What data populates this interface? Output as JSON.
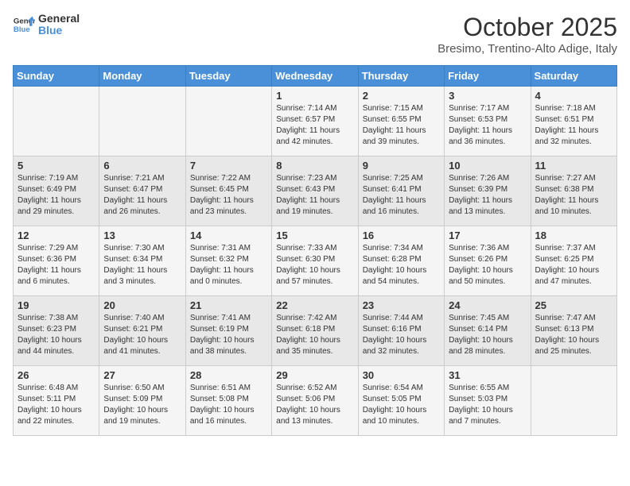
{
  "header": {
    "logo_line1": "General",
    "logo_line2": "Blue",
    "month": "October 2025",
    "location": "Bresimo, Trentino-Alto Adige, Italy"
  },
  "days_of_week": [
    "Sunday",
    "Monday",
    "Tuesday",
    "Wednesday",
    "Thursday",
    "Friday",
    "Saturday"
  ],
  "weeks": [
    [
      {
        "day": "",
        "content": ""
      },
      {
        "day": "",
        "content": ""
      },
      {
        "day": "",
        "content": ""
      },
      {
        "day": "1",
        "content": "Sunrise: 7:14 AM\nSunset: 6:57 PM\nDaylight: 11 hours and 42 minutes."
      },
      {
        "day": "2",
        "content": "Sunrise: 7:15 AM\nSunset: 6:55 PM\nDaylight: 11 hours and 39 minutes."
      },
      {
        "day": "3",
        "content": "Sunrise: 7:17 AM\nSunset: 6:53 PM\nDaylight: 11 hours and 36 minutes."
      },
      {
        "day": "4",
        "content": "Sunrise: 7:18 AM\nSunset: 6:51 PM\nDaylight: 11 hours and 32 minutes."
      }
    ],
    [
      {
        "day": "5",
        "content": "Sunrise: 7:19 AM\nSunset: 6:49 PM\nDaylight: 11 hours and 29 minutes."
      },
      {
        "day": "6",
        "content": "Sunrise: 7:21 AM\nSunset: 6:47 PM\nDaylight: 11 hours and 26 minutes."
      },
      {
        "day": "7",
        "content": "Sunrise: 7:22 AM\nSunset: 6:45 PM\nDaylight: 11 hours and 23 minutes."
      },
      {
        "day": "8",
        "content": "Sunrise: 7:23 AM\nSunset: 6:43 PM\nDaylight: 11 hours and 19 minutes."
      },
      {
        "day": "9",
        "content": "Sunrise: 7:25 AM\nSunset: 6:41 PM\nDaylight: 11 hours and 16 minutes."
      },
      {
        "day": "10",
        "content": "Sunrise: 7:26 AM\nSunset: 6:39 PM\nDaylight: 11 hours and 13 minutes."
      },
      {
        "day": "11",
        "content": "Sunrise: 7:27 AM\nSunset: 6:38 PM\nDaylight: 11 hours and 10 minutes."
      }
    ],
    [
      {
        "day": "12",
        "content": "Sunrise: 7:29 AM\nSunset: 6:36 PM\nDaylight: 11 hours and 6 minutes."
      },
      {
        "day": "13",
        "content": "Sunrise: 7:30 AM\nSunset: 6:34 PM\nDaylight: 11 hours and 3 minutes."
      },
      {
        "day": "14",
        "content": "Sunrise: 7:31 AM\nSunset: 6:32 PM\nDaylight: 11 hours and 0 minutes."
      },
      {
        "day": "15",
        "content": "Sunrise: 7:33 AM\nSunset: 6:30 PM\nDaylight: 10 hours and 57 minutes."
      },
      {
        "day": "16",
        "content": "Sunrise: 7:34 AM\nSunset: 6:28 PM\nDaylight: 10 hours and 54 minutes."
      },
      {
        "day": "17",
        "content": "Sunrise: 7:36 AM\nSunset: 6:26 PM\nDaylight: 10 hours and 50 minutes."
      },
      {
        "day": "18",
        "content": "Sunrise: 7:37 AM\nSunset: 6:25 PM\nDaylight: 10 hours and 47 minutes."
      }
    ],
    [
      {
        "day": "19",
        "content": "Sunrise: 7:38 AM\nSunset: 6:23 PM\nDaylight: 10 hours and 44 minutes."
      },
      {
        "day": "20",
        "content": "Sunrise: 7:40 AM\nSunset: 6:21 PM\nDaylight: 10 hours and 41 minutes."
      },
      {
        "day": "21",
        "content": "Sunrise: 7:41 AM\nSunset: 6:19 PM\nDaylight: 10 hours and 38 minutes."
      },
      {
        "day": "22",
        "content": "Sunrise: 7:42 AM\nSunset: 6:18 PM\nDaylight: 10 hours and 35 minutes."
      },
      {
        "day": "23",
        "content": "Sunrise: 7:44 AM\nSunset: 6:16 PM\nDaylight: 10 hours and 32 minutes."
      },
      {
        "day": "24",
        "content": "Sunrise: 7:45 AM\nSunset: 6:14 PM\nDaylight: 10 hours and 28 minutes."
      },
      {
        "day": "25",
        "content": "Sunrise: 7:47 AM\nSunset: 6:13 PM\nDaylight: 10 hours and 25 minutes."
      }
    ],
    [
      {
        "day": "26",
        "content": "Sunrise: 6:48 AM\nSunset: 5:11 PM\nDaylight: 10 hours and 22 minutes."
      },
      {
        "day": "27",
        "content": "Sunrise: 6:50 AM\nSunset: 5:09 PM\nDaylight: 10 hours and 19 minutes."
      },
      {
        "day": "28",
        "content": "Sunrise: 6:51 AM\nSunset: 5:08 PM\nDaylight: 10 hours and 16 minutes."
      },
      {
        "day": "29",
        "content": "Sunrise: 6:52 AM\nSunset: 5:06 PM\nDaylight: 10 hours and 13 minutes."
      },
      {
        "day": "30",
        "content": "Sunrise: 6:54 AM\nSunset: 5:05 PM\nDaylight: 10 hours and 10 minutes."
      },
      {
        "day": "31",
        "content": "Sunrise: 6:55 AM\nSunset: 5:03 PM\nDaylight: 10 hours and 7 minutes."
      },
      {
        "day": "",
        "content": ""
      }
    ]
  ]
}
